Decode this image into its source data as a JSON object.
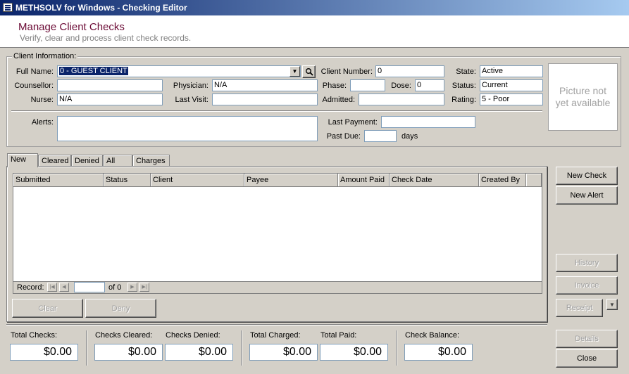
{
  "window": {
    "title": "METHSOLV for Windows - Checking Editor"
  },
  "header": {
    "title": "Manage Client Checks",
    "subtitle": "Verify, clear and process client check records."
  },
  "client_info": {
    "group_label": "Client Information:",
    "full_name_label": "Full Name:",
    "full_name_value": "0 - GUEST CLIENT",
    "client_number_label": "Client Number:",
    "client_number_value": "0",
    "state_label": "State:",
    "state_value": "Active",
    "counsellor_label": "Counsellor:",
    "counsellor_value": "",
    "physician_label": "Physician:",
    "physician_value": "N/A",
    "phase_label": "Phase:",
    "phase_value": "",
    "dose_label": "Dose:",
    "dose_value": "0",
    "status_label": "Status:",
    "status_value": "Current",
    "nurse_label": "Nurse:",
    "nurse_value": "N/A",
    "last_visit_label": "Last Visit:",
    "last_visit_value": "",
    "admitted_label": "Admitted:",
    "admitted_value": "",
    "rating_label": "Rating:",
    "rating_value": "5 - Poor",
    "alerts_label": "Alerts:",
    "alerts_value": "",
    "last_payment_label": "Last Payment:",
    "last_payment_value": "",
    "past_due_label": "Past Due:",
    "past_due_value": "",
    "days_label": "days",
    "picture_text": "Picture not yet available"
  },
  "tabs": [
    "New",
    "Cleared",
    "Denied",
    "All",
    "Charges"
  ],
  "grid": {
    "columns": [
      "Submitted",
      "Status",
      "Client",
      "Payee",
      "Amount Paid",
      "Check Date",
      "Created By"
    ],
    "record_label": "Record:",
    "record_value": "",
    "of_label": "of 0"
  },
  "buttons": {
    "clear": "Clear",
    "deny": "Deny",
    "new_check": "New Check",
    "new_alert": "New Alert",
    "history": "History",
    "invoice": "Invoice",
    "receipt": "Receipt",
    "details": "Details",
    "close": "Close"
  },
  "totals": {
    "total_checks_label": "Total Checks:",
    "total_checks_value": "$0.00",
    "checks_cleared_label": "Checks Cleared:",
    "checks_cleared_value": "$0.00",
    "checks_denied_label": "Checks Denied:",
    "checks_denied_value": "$0.00",
    "total_charged_label": "Total Charged:",
    "total_charged_value": "$0.00",
    "total_paid_label": "Total Paid:",
    "total_paid_value": "$0.00",
    "check_balance_label": "Check Balance:",
    "check_balance_value": "$0.00"
  },
  "icons": {
    "app": "app-window-icon",
    "search": "magnifier-icon",
    "dropdown": "chevron-down-icon"
  }
}
